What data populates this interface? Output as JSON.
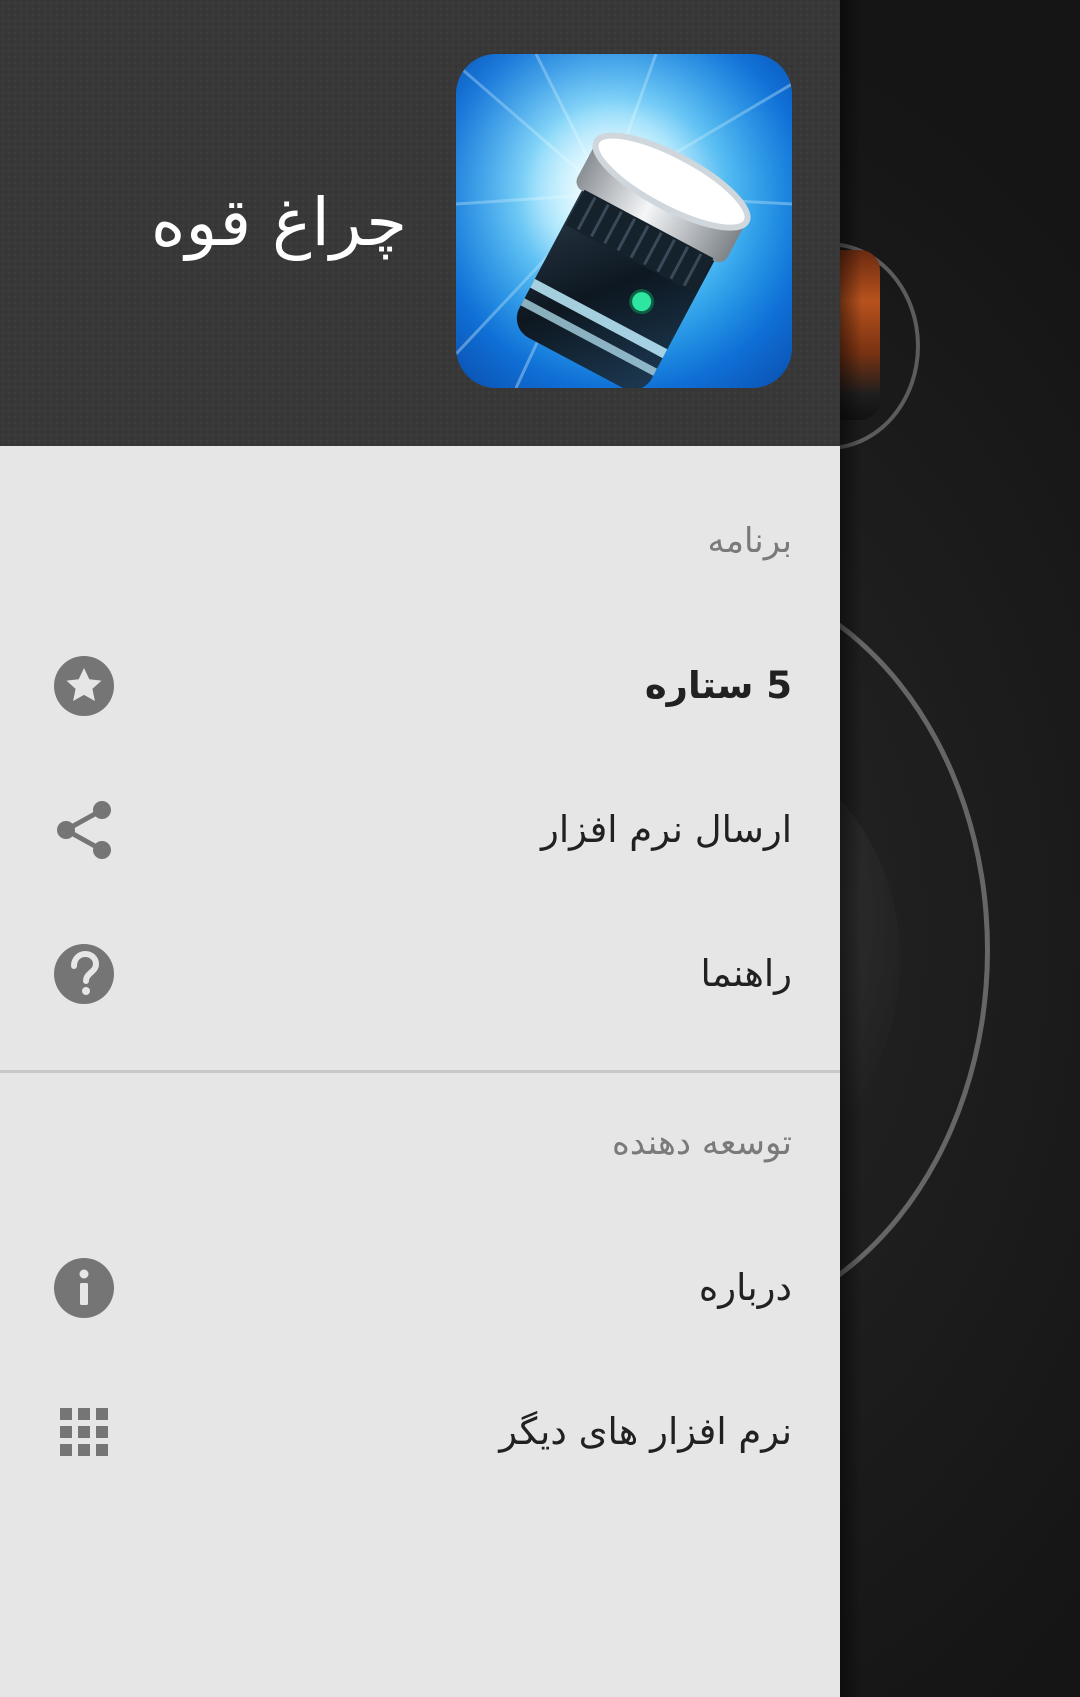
{
  "drawer": {
    "app_title": "چراغ قوه",
    "sections": [
      {
        "header": "برنامه",
        "items": [
          {
            "label": "5 ستاره",
            "icon": "star-icon",
            "bold": true
          },
          {
            "label": "ارسال نرم افزار",
            "icon": "share-icon"
          },
          {
            "label": "راهنما",
            "icon": "help-icon"
          }
        ]
      },
      {
        "header": "توسعه دهنده",
        "items": [
          {
            "label": "درباره",
            "icon": "info-icon"
          },
          {
            "label": "نرم افزار های دیگر",
            "icon": "grid-icon"
          }
        ]
      }
    ]
  },
  "colors": {
    "header_bg": "#383838",
    "drawer_bg": "#e6e6e6",
    "icon_gray": "#757575",
    "section_header_text": "#7a7a7a",
    "item_text": "#212121"
  }
}
